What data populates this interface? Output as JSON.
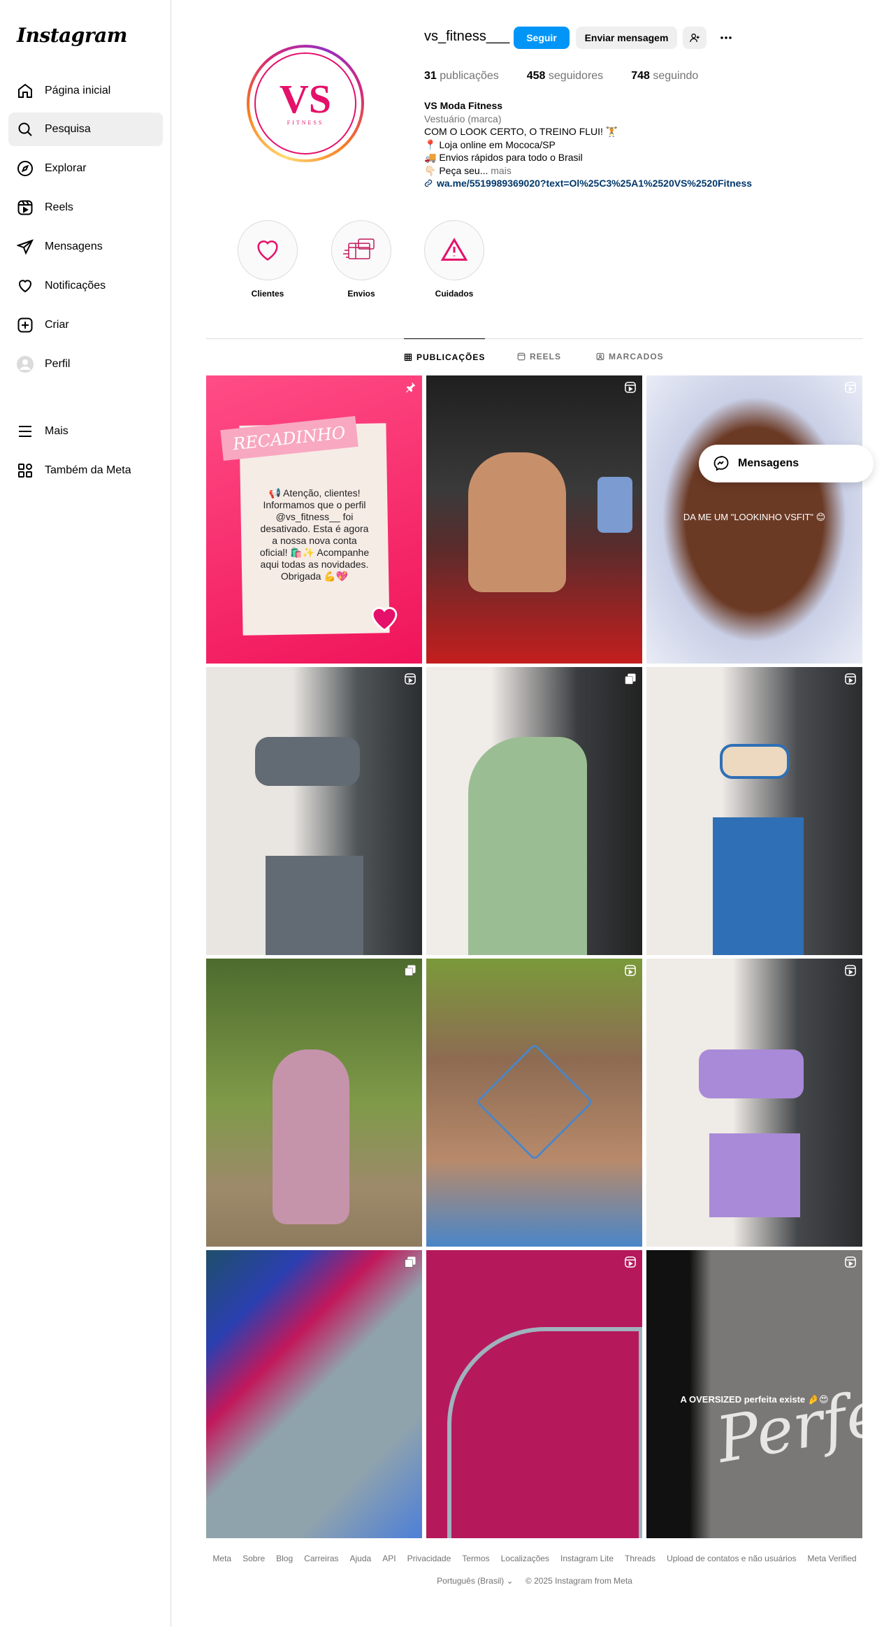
{
  "sidebar": {
    "logo": "Instagram",
    "items": [
      {
        "label": "Página inicial",
        "icon": "home-icon"
      },
      {
        "label": "Pesquisa",
        "icon": "search-icon"
      },
      {
        "label": "Explorar",
        "icon": "compass-icon"
      },
      {
        "label": "Reels",
        "icon": "reels-icon"
      },
      {
        "label": "Mensagens",
        "icon": "paper-plane-icon"
      },
      {
        "label": "Notificações",
        "icon": "heart-icon"
      },
      {
        "label": "Criar",
        "icon": "plus-square-icon"
      },
      {
        "label": "Perfil",
        "icon": "avatar-icon"
      }
    ],
    "more_label": "Mais",
    "meta_label": "Também da Meta"
  },
  "profile": {
    "username": "vs_fitness___",
    "follow_label": "Seguir",
    "message_label": "Enviar mensagem",
    "stats": {
      "posts_count": "31",
      "posts_label": "publicações",
      "followers_count": "458",
      "followers_label": "seguidores",
      "following_count": "748",
      "following_label": "seguindo"
    },
    "bio": {
      "name": "VS Moda Fitness",
      "category": "Vestuário (marca)",
      "line1": "COM O LOOK CERTO, O TREINO FLUI! 🏋️",
      "line2": "📍 Loja online em Mococa/SP",
      "line3": "🚚 Envios rápidos para todo o Brasil",
      "line4": "👇🏻 Peça seu...",
      "more": "mais",
      "link": "wa.me/5519989369020?text=Ol%25C3%25A1%2520VS%2520Fitness"
    },
    "avatar_text": "VS",
    "avatar_subtext": "FITNESS"
  },
  "highlights": [
    {
      "label": "Clientes",
      "icon": "heart-outline-icon"
    },
    {
      "label": "Envios",
      "icon": "package-icon"
    },
    {
      "label": "Cuidados",
      "icon": "warning-icon"
    }
  ],
  "tabs": {
    "posts": "PUBLICAÇÕES",
    "reels": "REELS",
    "tagged": "MARCADOS"
  },
  "posts": [
    {
      "kind": "pinned",
      "title": "RECADINHO",
      "text": "📢 Atenção, clientes! Informamos que o perfil @vs_fitness__ foi desativado. Esta é agora a nossa nova conta oficial! 🛍️✨ Acompanhe aqui todas as novidades. Obrigada 💪💖",
      "bg": "#f5346f"
    },
    {
      "kind": "reel",
      "bg": "#3a3a3a"
    },
    {
      "kind": "reel",
      "overlay": "DA ME UM \"LOOKINHO VSFIT\" 😊",
      "bg": "#6b3a25"
    },
    {
      "kind": "reel",
      "bg": "#626a73"
    },
    {
      "kind": "carousel",
      "bg": "#9bbd93"
    },
    {
      "kind": "reel",
      "bg": "#2f6fb5"
    },
    {
      "kind": "carousel",
      "bg": "#5f7a3a"
    },
    {
      "kind": "reel",
      "bg": "#4a86c8"
    },
    {
      "kind": "reel",
      "bg": "#a98ad8"
    },
    {
      "kind": "carousel",
      "bg": "#6f8fa3"
    },
    {
      "kind": "reel",
      "bg": "#b5195b"
    },
    {
      "kind": "reel",
      "overlay": "A OVERSIZED perfeita existe 🤌😍",
      "big_text": "Perfe",
      "bg": "#7a7876"
    }
  ],
  "message_pill": "Mensagens",
  "footer": {
    "links": [
      "Meta",
      "Sobre",
      "Blog",
      "Carreiras",
      "Ajuda",
      "API",
      "Privacidade",
      "Termos",
      "Localizações",
      "Instagram Lite",
      "Threads",
      "Upload de contatos e não usuários",
      "Meta Verified"
    ],
    "language": "Português (Brasil)",
    "copyright": "© 2025 Instagram from Meta"
  },
  "colors": {
    "follow_button": "#0095f6",
    "secondary_button": "#efefef",
    "link": "#00376b"
  }
}
